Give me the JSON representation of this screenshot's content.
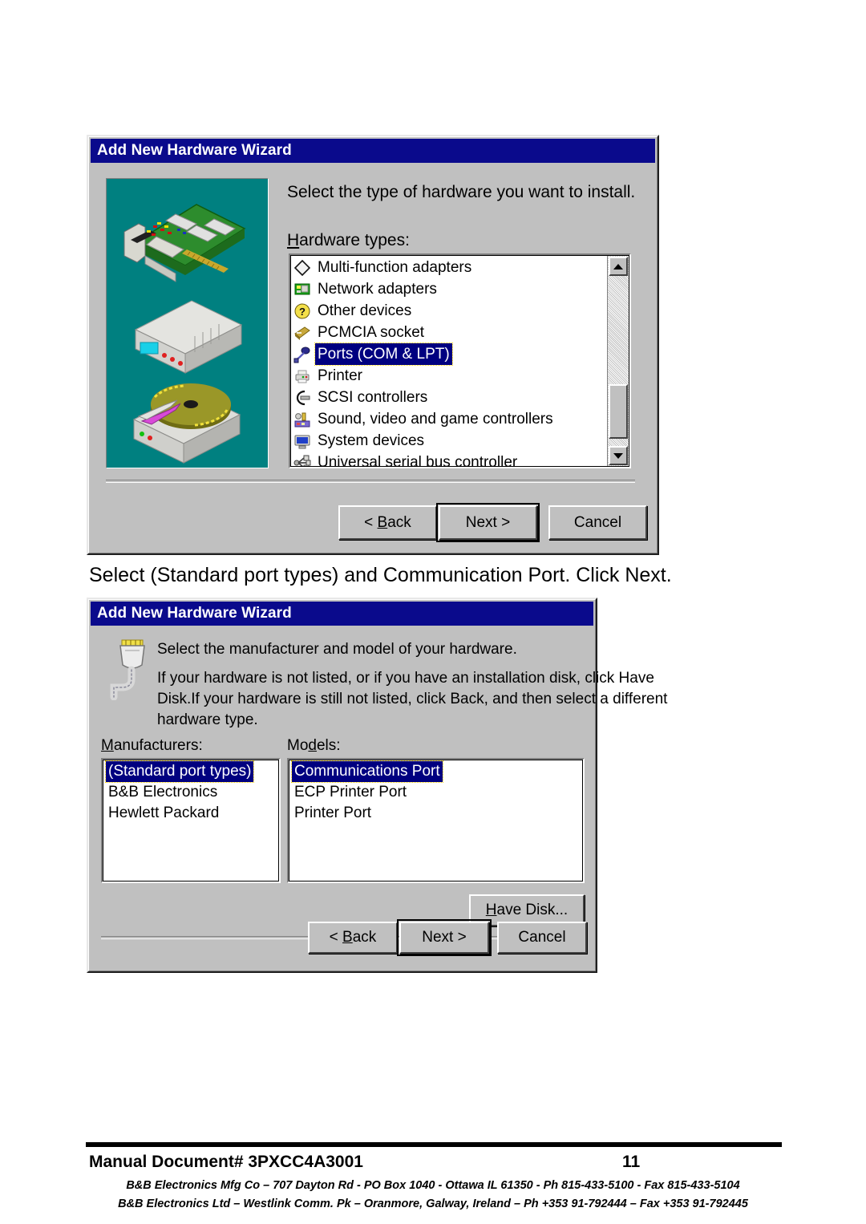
{
  "page": {
    "caption_between_dialogs": "Select (Standard port types) and Communication Port. Click Next."
  },
  "dialog1": {
    "title": "Add New Hardware Wizard",
    "prompt": "Select the type of hardware you want to install.",
    "list_label": "Hardware types:",
    "list_label_accel": "H",
    "list_label_rest": "ardware types:",
    "hardware_types": [
      {
        "label": "Multi-function adapters",
        "icon": "diamond-adapter-icon",
        "selected": false
      },
      {
        "label": "Network adapters",
        "icon": "network-card-icon",
        "selected": false
      },
      {
        "label": "Other devices",
        "icon": "question-mark-icon",
        "selected": false
      },
      {
        "label": "PCMCIA socket",
        "icon": "pcmcia-card-icon",
        "selected": false
      },
      {
        "label": "Ports (COM & LPT)",
        "icon": "serial-port-icon",
        "selected": true
      },
      {
        "label": "Printer",
        "icon": "printer-icon",
        "selected": false
      },
      {
        "label": "SCSI controllers",
        "icon": "scsi-controller-icon",
        "selected": false
      },
      {
        "label": "Sound, video and game controllers",
        "icon": "sound-video-icon",
        "selected": false
      },
      {
        "label": "System devices",
        "icon": "monitor-icon",
        "selected": false
      },
      {
        "label": "Universal serial bus controller",
        "icon": "usb-icon",
        "selected": false
      }
    ],
    "buttons": {
      "back": "< Back",
      "back_accel": "B",
      "next": "Next >",
      "cancel": "Cancel"
    },
    "illustration_bg": "#008080"
  },
  "dialog2": {
    "title": "Add New Hardware Wizard",
    "icon": "plug-connector-icon",
    "prompt": "Select the manufacturer and model of your hardware.",
    "body_line1": "If your hardware is not listed, or if you have an installation disk, click Have",
    "body_line2": "Disk.If your hardware is still not listed, click Back, and then select a different",
    "body_line3": "hardware type.",
    "manufacturers_label": "Manufacturers:",
    "manufacturers_accel": "M",
    "manufacturers_rest": "anufacturers:",
    "models_label": "Models:",
    "models_pre": "Mo",
    "models_accel": "d",
    "models_rest": "els:",
    "manufacturers": [
      {
        "label": "(Standard port types)",
        "selected": true
      },
      {
        "label": "B&B Electronics",
        "selected": false
      },
      {
        "label": "Hewlett Packard",
        "selected": false
      }
    ],
    "models": [
      {
        "label": "Communications Port",
        "selected": true
      },
      {
        "label": "ECP Printer Port",
        "selected": false
      },
      {
        "label": "Printer Port",
        "selected": false
      }
    ],
    "buttons": {
      "have_disk": "Have Disk...",
      "have_disk_accel": "H",
      "have_disk_rest": "ave Disk...",
      "back": "< Back",
      "back_accel": "B",
      "next": "Next >",
      "cancel": "Cancel"
    }
  },
  "footer": {
    "document": "Manual Document# 3PXCC4A3001",
    "page_number": "11",
    "address_line1": "B&B Electronics Mfg Co – 707 Dayton Rd - PO Box 1040 - Ottawa IL 61350 - Ph 815-433-5100 - Fax 815-433-5104",
    "address_line2": "B&B Electronics Ltd – Westlink Comm. Pk – Oranmore, Galway, Ireland – Ph +353 91-792444 – Fax +353 91-792445"
  },
  "colors": {
    "titlebar": "#0a0a8c",
    "dialog_face": "#c0c0c0",
    "selection": "#000080",
    "illustration": "#008080",
    "focus_dotted": "#ffd700"
  }
}
